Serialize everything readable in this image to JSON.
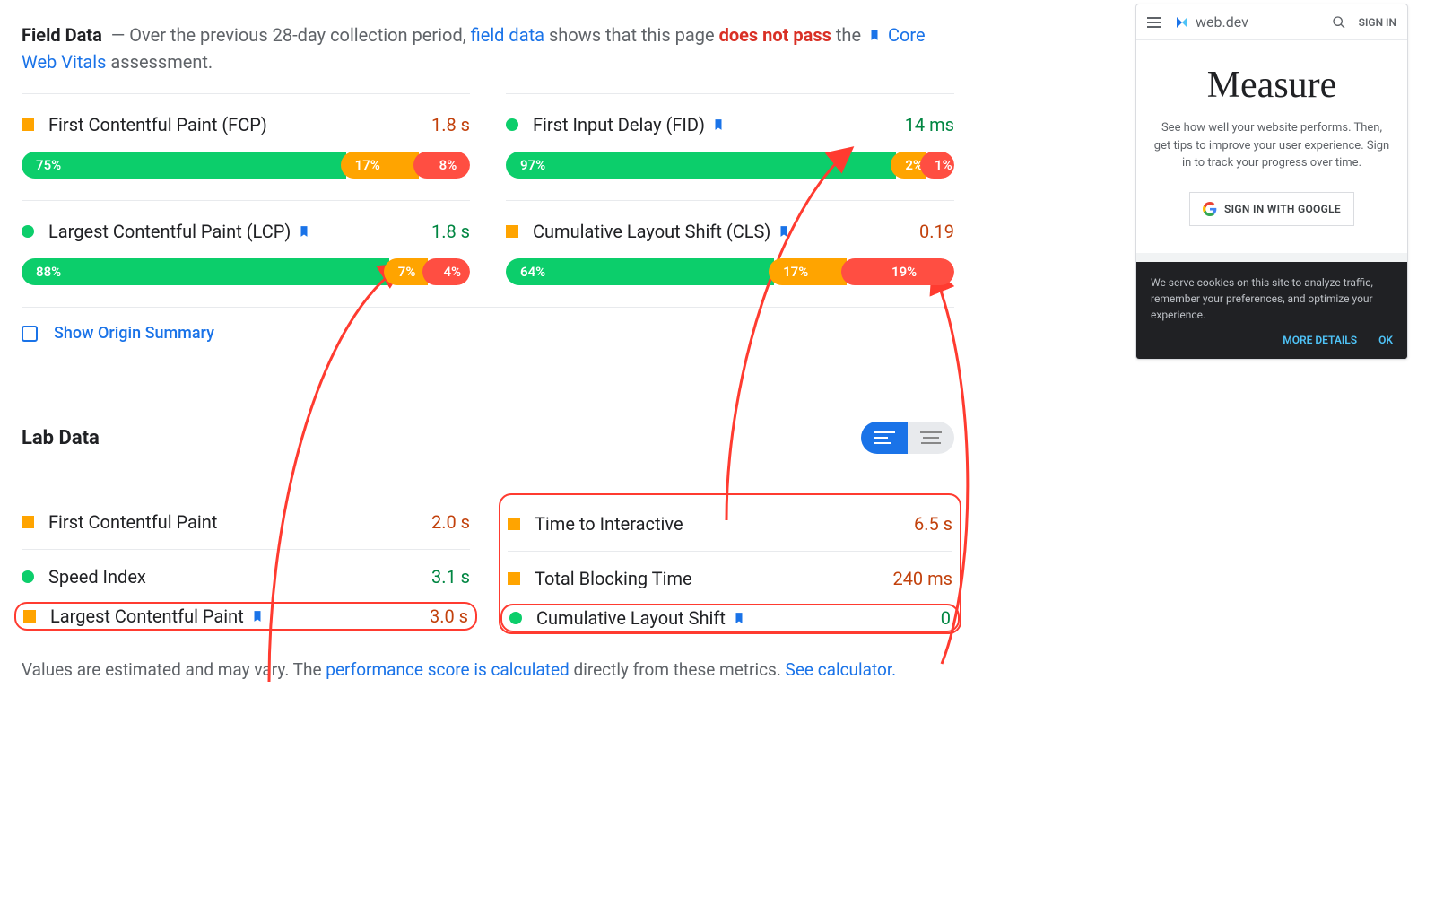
{
  "field": {
    "title": "Field Data",
    "pre": "— Over the previous 28-day collection period, ",
    "link1": "field data",
    "mid1": " shows that this page ",
    "bad": "does not pass",
    "mid2": " the ",
    "link2": "Core Web Vitals",
    "suffix": " assessment."
  },
  "metrics": {
    "fcp": {
      "name": "First Contentful Paint (FCP)",
      "val": "1.8 s",
      "g": "75%",
      "o": "17%",
      "r": "8%"
    },
    "fid": {
      "name": "First Input Delay (FID)",
      "val": "14 ms",
      "g": "97%",
      "o": "2%",
      "r": "1%"
    },
    "lcp": {
      "name": "Largest Contentful Paint (LCP)",
      "val": "1.8 s",
      "g": "88%",
      "o": "7%",
      "r": "4%"
    },
    "cls": {
      "name": "Cumulative Layout Shift (CLS)",
      "val": "0.19",
      "g": "64%",
      "o": "17%",
      "r": "19%"
    }
  },
  "origin": {
    "label": "Show Origin Summary"
  },
  "lab": {
    "title": "Lab Data",
    "rows": {
      "fcp": {
        "name": "First Contentful Paint",
        "val": "2.0 s"
      },
      "tti": {
        "name": "Time to Interactive",
        "val": "6.5 s"
      },
      "si": {
        "name": "Speed Index",
        "val": "3.1 s"
      },
      "tbt": {
        "name": "Total Blocking Time",
        "val": "240 ms"
      },
      "lcp": {
        "name": "Largest Contentful Paint",
        "val": "3.0 s"
      },
      "cls": {
        "name": "Cumulative Layout Shift",
        "val": "0"
      }
    }
  },
  "footnote": {
    "t1": "Values are estimated and may vary. The ",
    "link1": "performance score is calculated",
    "t2": " directly from these metrics. ",
    "link2": "See calculator."
  },
  "phone": {
    "brand": "web.dev",
    "signin": "SIGN IN",
    "heading": "Measure",
    "desc": "See how well your website performs. Then, get tips to improve your user experience. Sign in to track your progress over time.",
    "button": "SIGN IN WITH GOOGLE",
    "cookie": "We serve cookies on this site to analyze traffic, remember your preferences, and optimize your experience.",
    "more": "MORE DETAILS",
    "ok": "OK"
  }
}
